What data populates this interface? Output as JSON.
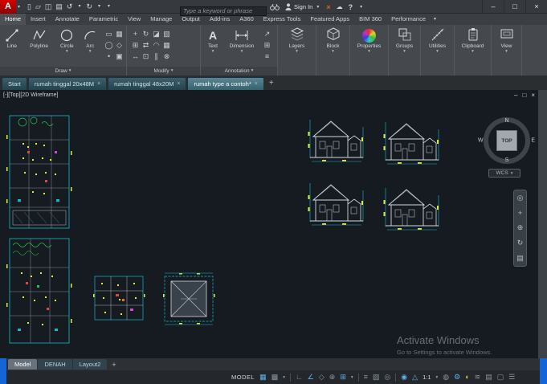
{
  "title_bar": {
    "search_placeholder": "Type a keyword or phrase",
    "sign_in_label": "Sign In"
  },
  "glyphs": {
    "app_a": "A",
    "dropdown": "▾",
    "win_min": "–",
    "win_max": "□",
    "win_close": "×",
    "tab_close": "×",
    "plus": "+",
    "qat_new": "▯",
    "qat_open": "▱",
    "qat_save": "◫",
    "qat_print": "▤",
    "qat_undo": "↺",
    "qat_redo": "↻",
    "exchange": "×",
    "a360_cloud": "☁",
    "help": "?",
    "text_tool": "A",
    "draw_rect": "▭",
    "draw_ellipse": "◯",
    "draw_hatch": "▦",
    "draw_polygon": "◇",
    "draw_point": "•",
    "draw_region": "▣",
    "mod_move": "+",
    "mod_copy": "⊞",
    "mod_rotate": "↻",
    "mod_mirror": "⇄",
    "mod_stretch": "↔",
    "mod_scale": "⊡",
    "mod_trim": "◪",
    "mod_fillet": "◠",
    "mod_array": "▦",
    "mod_erase": "▧",
    "mod_offset": "∥",
    "mod_explode": "⊗",
    "anno_leader": "↗",
    "anno_table": "⊞",
    "anno_style": "≡",
    "nav_wheel": "◎",
    "nav_pan": "+",
    "nav_zoom": "⊕",
    "nav_orbit": "↻",
    "nav_motion": "▤"
  },
  "ribbon": {
    "tabs": [
      "Home",
      "Insert",
      "Annotate",
      "Parametric",
      "View",
      "Manage",
      "Output",
      "Add-ins",
      "A360",
      "Express Tools",
      "Featured Apps",
      "BIM 360",
      "Performance"
    ],
    "draw": {
      "label": "Draw",
      "line": "Line",
      "polyline": "Polyline",
      "circle": "Circle",
      "arc": "Arc"
    },
    "modify": {
      "label": "Modify"
    },
    "annotation": {
      "label": "Annotation",
      "text": "Text",
      "dimension": "Dimension"
    },
    "layers": "Layers",
    "block": "Block",
    "properties": "Properties",
    "groups": "Groups",
    "utilities": "Utilities",
    "clipboard": "Clipboard",
    "view": "View"
  },
  "file_tabs": [
    "Start",
    "rumah tinggal 20x48M",
    "rumah tinggal 48x20M",
    "rumah type a contoh*"
  ],
  "viewport": {
    "label": "[-][Top][2D Wireframe]",
    "viewcube": {
      "n": "N",
      "w": "W",
      "e": "E",
      "s": "S",
      "top": "TOP",
      "wcs": "WCS"
    },
    "watermark_line1": "Activate Windows",
    "watermark_line2": "Go to Settings to activate Windows."
  },
  "layout_tabs": {
    "model": "Model",
    "denah": "DENAH",
    "layout2": "Layout2"
  },
  "status_bar": {
    "model": "MODEL",
    "scale": "1:1",
    "icons": {
      "grid": "▦",
      "snap": "▩",
      "ortho": "∟",
      "polar": "∠",
      "iso": "◇",
      "otrack": "⊕",
      "osnap": "⊞",
      "lwt": "≡",
      "transp": "▨",
      "cycle": "◎",
      "annovis": "◉",
      "autoscale": "△",
      "monitor": "◍",
      "gear": "⚙",
      "isolate": "◐",
      "perf": "≋",
      "quickprop": "▤",
      "clean": "▢",
      "menu": "☰"
    }
  },
  "colors": {
    "accent_blue": "#5fb2e6",
    "cad_cyan": "#17b9c9",
    "cad_yellow": "#e8e83a",
    "cad_red": "#e04545",
    "cad_green": "#2dc24c"
  }
}
